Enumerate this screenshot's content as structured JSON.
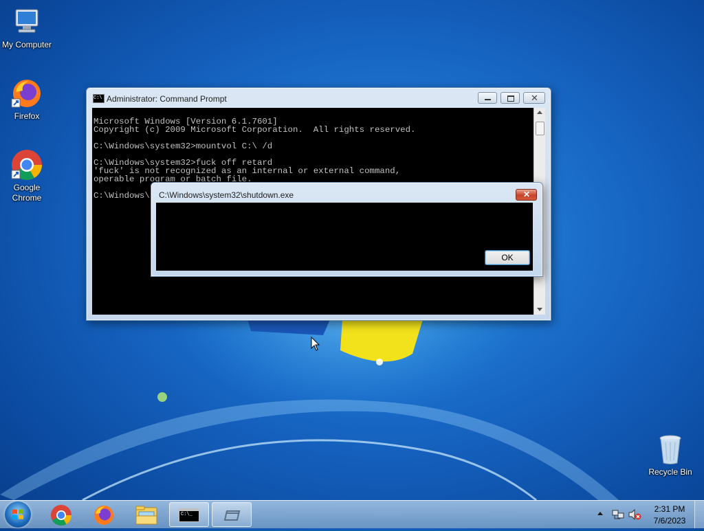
{
  "desktop": {
    "icons": [
      {
        "label": "My Computer",
        "icon": "computer-icon"
      },
      {
        "label": "Firefox",
        "icon": "firefox-icon"
      },
      {
        "label_line1": "Google",
        "label_line2": "Chrome",
        "icon": "chrome-icon"
      },
      {
        "label": "Recycle Bin",
        "icon": "recycle-bin-icon"
      }
    ]
  },
  "cmd_window": {
    "title": "Administrator: Command Prompt",
    "lines": [
      "Microsoft Windows [Version 6.1.7601]",
      "Copyright (c) 2009 Microsoft Corporation.  All rights reserved.",
      "",
      "C:\\Windows\\system32>mountvol C:\\ /d",
      "",
      "C:\\Windows\\system32>fuck off retard",
      "'fuck' is not recognized as an internal or external command,",
      "operable program or batch file.",
      "",
      "C:\\Windows\\system32>"
    ]
  },
  "dialog": {
    "title": "C:\\Windows\\system32\\shutdown.exe",
    "ok_label": "OK"
  },
  "taskbar": {
    "start_icon": "windows-start-icon",
    "pinned": [
      "chrome-icon",
      "firefox-icon",
      "file-explorer-icon",
      "command-prompt-icon",
      "blank-window-icon"
    ],
    "time": "2:31 PM",
    "date": "7/6/2023",
    "cmd_button_text": "C:\\_"
  },
  "colors": {
    "console_bg": "#000000",
    "console_fg": "#c0c0c0",
    "close_red": "#c7442a"
  }
}
